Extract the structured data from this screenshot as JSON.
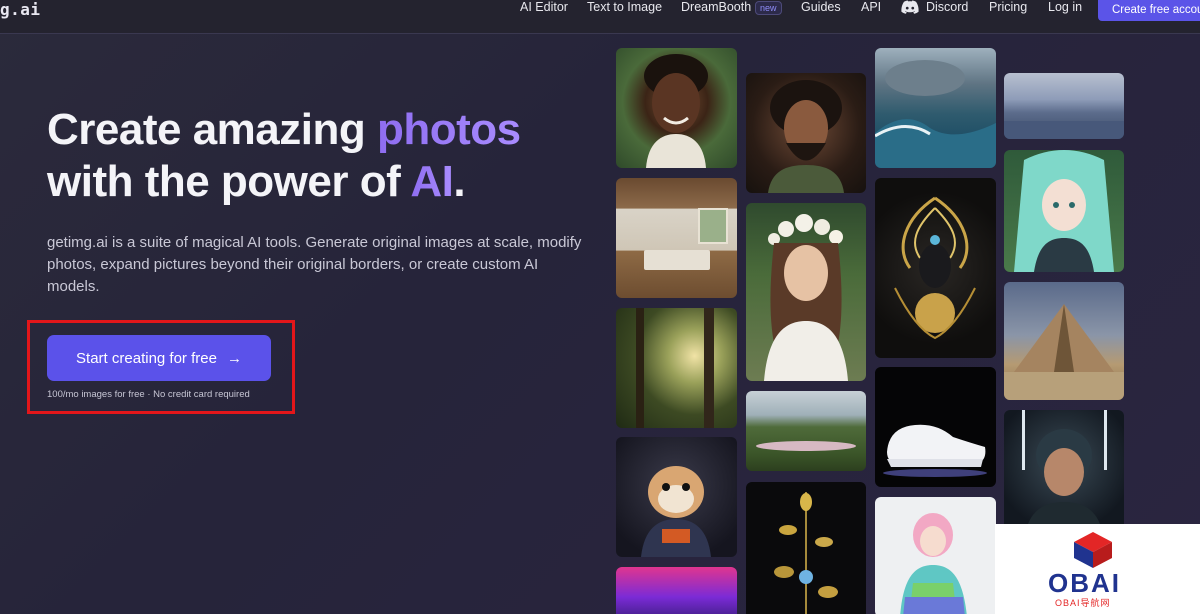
{
  "nav": {
    "logo": "g.ai",
    "items": [
      "AI Editor",
      "Text to Image",
      "DreamBooth",
      "Guides",
      "API",
      "Discord",
      "Pricing",
      "Log in"
    ],
    "new_badge": "new",
    "cta": "Create free account"
  },
  "hero": {
    "title_line1_a": "Create amazing ",
    "title_line1_b": "photos",
    "title_line2_a": "with the power of ",
    "title_line2_b": "AI",
    "title_line2_c": ".",
    "description": "getimg.ai is a suite of magical AI tools. Generate original images at scale, modify photos, expand pictures beyond their original borders, or create custom AI models.",
    "cta_label": "Start creating for free",
    "cta_arrow": "→",
    "cta_note": "100/mo images for free · No credit card required"
  },
  "gallery": {
    "tiles": [
      "portrait-man-smiling",
      "bedroom-interior",
      "forest-path",
      "hamster-astronaut",
      "neon-city",
      "bearded-warrior",
      "flower-crown-woman",
      "garden-landscape",
      "golden-flower-sculpture",
      "stormy-ocean",
      "golden-mask-sculpture",
      "white-sneaker",
      "pink-hair-character",
      "cloudy-seascape",
      "anime-girl",
      "pyramid",
      "cyber-helmet-man"
    ]
  },
  "watermark": {
    "text": "OBAI",
    "sub": "OBAI导航网"
  }
}
